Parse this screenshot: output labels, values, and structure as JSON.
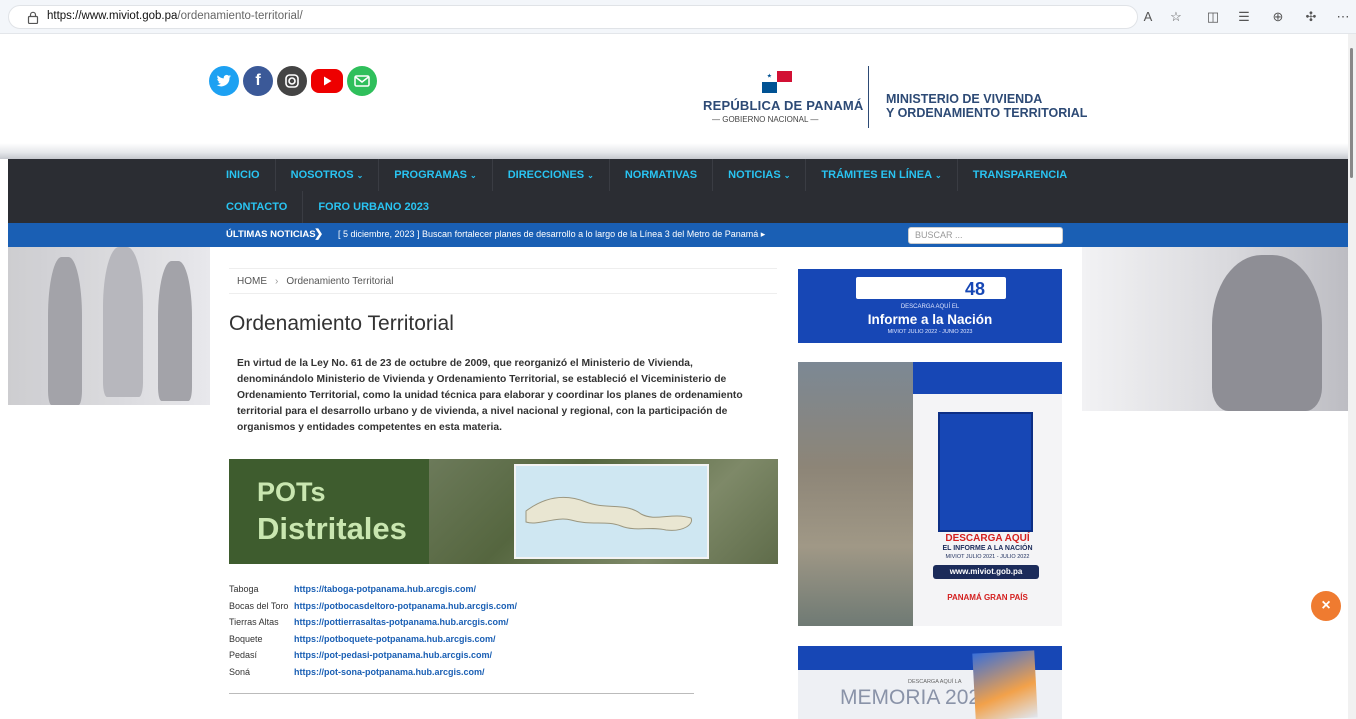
{
  "browser": {
    "url_host": "https://www.miviot.gob.pa",
    "url_path": "/ordenamiento-territorial/",
    "icons": [
      "read-aloud-icon",
      "favorite-star-icon",
      "split-screen-icon",
      "favorites-list-icon",
      "collections-icon",
      "extensions-icon",
      "more-icon"
    ]
  },
  "header": {
    "social": [
      "twitter",
      "facebook",
      "instagram",
      "youtube",
      "email"
    ],
    "gov_title": "REPÚBLICA DE PANAMÁ",
    "gov_sub": "— GOBIERNO NACIONAL —",
    "ministry_line1": "MINISTERIO DE VIVIENDA",
    "ministry_line2": "Y ORDENAMIENTO TERRITORIAL"
  },
  "nav": {
    "row1": [
      {
        "label": "INICIO",
        "dropdown": false
      },
      {
        "label": "NOSOTROS",
        "dropdown": true
      },
      {
        "label": "PROGRAMAS",
        "dropdown": true
      },
      {
        "label": "DIRECCIONES",
        "dropdown": true
      },
      {
        "label": "NORMATIVAS",
        "dropdown": false
      },
      {
        "label": "NOTICIAS",
        "dropdown": true
      },
      {
        "label": "TRÁMITES EN LÍNEA",
        "dropdown": true
      },
      {
        "label": "TRANSPARENCIA",
        "dropdown": false
      }
    ],
    "row2": [
      {
        "label": "CONTACTO",
        "dropdown": false
      },
      {
        "label": "FORO URBANO 2023",
        "dropdown": false
      }
    ]
  },
  "ticker": {
    "label": "ÚLTIMAS NOTICIAS",
    "arrow": "❯",
    "text": "[ 5 diciembre, 2023 ]  Buscan fortalecer planes de desarrollo a lo largo de la Línea 3 del Metro de Panamá  ▸",
    "search_placeholder": "BUSCAR ..."
  },
  "main": {
    "breadcrumb_home": "HOME",
    "breadcrumb_sep": "›",
    "breadcrumb_current": "Ordenamiento Territorial",
    "title": "Ordenamiento Territorial",
    "intro": "En virtud de la Ley No. 61 de 23 de octubre de 2009, que reorganizó el Ministerio de Vivienda, denominándolo Ministerio de Vivienda y Ordenamiento Territorial, se estableció el Viceministerio de Ordenamiento Territorial, como la unidad técnica para elaborar y coordinar los planes de ordenamiento territorial para el desarrollo urbano y de vivienda, a nivel nacional y regional, con la participación de organismos y entidades competentes en esta materia.",
    "banner_line1": "POTs",
    "banner_line2": "Distritales",
    "pots": [
      {
        "name": "Taboga",
        "link": "https://taboga-potpanama.hub.arcgis.com/"
      },
      {
        "name": "Bocas del Toro",
        "link": "https://potbocasdeltoro-potpanama.hub.arcgis.com/"
      },
      {
        "name": "Tierras Altas",
        "link": "https://pottierrasaltas-potpanama.hub.arcgis.com/"
      },
      {
        "name": "Boquete",
        "link": "https://potboquete-potpanama.hub.arcgis.com/"
      },
      {
        "name": "Pedasí",
        "link": "https://pot-pedasi-potpanama.hub.arcgis.com/"
      },
      {
        "name": "Soná",
        "link": "https://pot-sona-potpanama.hub.arcgis.com/"
      }
    ]
  },
  "sidebar": {
    "ad1_meses": "48",
    "ad1_t1": "DESCARGA AQUÍ EL",
    "ad1_t2": "Informe a la Nación",
    "ad1_t3": "MIVIOT JULIO 2022 - JUNIO 2023",
    "ad2_d1": "DESCARGA AQUÍ",
    "ad2_d2": "EL INFORME A LA NACIÓN",
    "ad2_d3": "MIVIOT JULIO 2021 - JULIO 2022",
    "ad2_url": "www.miviot.gob.pa",
    "ad2_slogan": "PANAMÁ GRAN PAÍS",
    "ad3_t1": "DESCARGA AQUÍ LA",
    "ad3_t2": "MEMORIA 2022"
  },
  "close_label": "×",
  "colors": {
    "nav_bg": "#2b2d33",
    "nav_link": "#29c4f2",
    "ticker_bg": "#1a5fb4",
    "ministry_blue": "#2d4a75",
    "close_orange": "#ef7b30"
  }
}
